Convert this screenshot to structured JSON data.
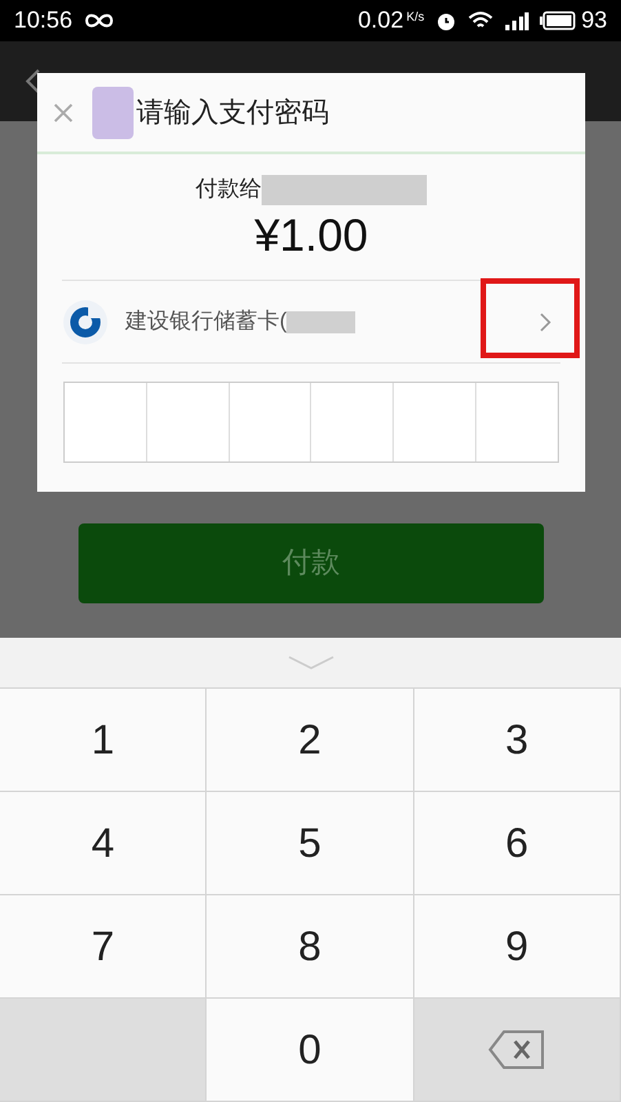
{
  "status_bar": {
    "time": "10:56",
    "speed": "0.02",
    "speed_unit": "K/s",
    "battery": "93"
  },
  "page": {
    "pay_button": "付款"
  },
  "dialog": {
    "title": "请输入支付密码",
    "payee": "付款给",
    "amount": "¥1.00",
    "card": "建设银行储蓄卡("
  },
  "keypad": {
    "keys": [
      {
        "kind": "digit",
        "label": "1"
      },
      {
        "kind": "digit",
        "label": "2"
      },
      {
        "kind": "digit",
        "label": "3"
      },
      {
        "kind": "digit",
        "label": "4"
      },
      {
        "kind": "digit",
        "label": "5"
      },
      {
        "kind": "digit",
        "label": "6"
      },
      {
        "kind": "digit",
        "label": "7"
      },
      {
        "kind": "digit",
        "label": "8"
      },
      {
        "kind": "digit",
        "label": "9"
      },
      {
        "kind": "blank"
      },
      {
        "kind": "digit",
        "label": "0"
      },
      {
        "kind": "delete"
      }
    ]
  }
}
